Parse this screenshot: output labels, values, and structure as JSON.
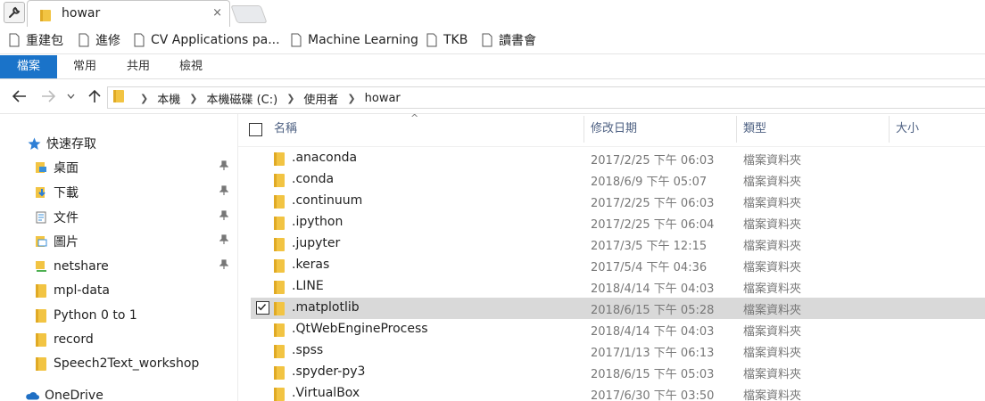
{
  "browser": {
    "tab_title": "howar",
    "tab_close": "×"
  },
  "bookmarks": [
    {
      "label": "重建包"
    },
    {
      "label": "進修"
    },
    {
      "label": "CV Applications pa..."
    },
    {
      "label": "Machine Learning"
    },
    {
      "label": "TKB"
    },
    {
      "label": "讀書會"
    }
  ],
  "ribbon": {
    "tabs": [
      {
        "label": "檔案"
      },
      {
        "label": "常用"
      },
      {
        "label": "共用"
      },
      {
        "label": "檢視"
      }
    ]
  },
  "address": {
    "crumbs": [
      "本機",
      "本機磁碟 (C:)",
      "使用者",
      "howar"
    ]
  },
  "nav": {
    "items": [
      {
        "label": "快速存取",
        "icon": "star-icon"
      },
      {
        "label": "桌面",
        "icon": "desktop-icon",
        "pinned": true
      },
      {
        "label": "下載",
        "icon": "download-icon",
        "pinned": true
      },
      {
        "label": "文件",
        "icon": "document-icon",
        "pinned": true
      },
      {
        "label": "圖片",
        "icon": "pictures-icon",
        "pinned": true
      },
      {
        "label": "netshare",
        "icon": "network-folder-icon",
        "pinned": true
      },
      {
        "label": "mpl-data",
        "icon": "folder-icon"
      },
      {
        "label": "Python 0 to 1",
        "icon": "folder-icon"
      },
      {
        "label": "record",
        "icon": "folder-icon"
      },
      {
        "label": "Speech2Text_workshop",
        "icon": "folder-icon"
      },
      {
        "label": "OneDrive",
        "icon": "cloud-icon"
      }
    ]
  },
  "columns": {
    "name": "名稱",
    "date": "修改日期",
    "type": "類型",
    "size": "大小",
    "sort_indicator": "^"
  },
  "files": [
    {
      "name": ".anaconda",
      "date": "2017/2/25 下午 06:03",
      "type": "檔案資料夾"
    },
    {
      "name": ".conda",
      "date": "2018/6/9 下午 05:07",
      "type": "檔案資料夾"
    },
    {
      "name": ".continuum",
      "date": "2017/2/25 下午 06:03",
      "type": "檔案資料夾"
    },
    {
      "name": ".ipython",
      "date": "2017/2/25 下午 06:04",
      "type": "檔案資料夾"
    },
    {
      "name": ".jupyter",
      "date": "2017/3/5 下午 12:15",
      "type": "檔案資料夾"
    },
    {
      "name": ".keras",
      "date": "2017/5/4 下午 04:36",
      "type": "檔案資料夾"
    },
    {
      "name": ".LINE",
      "date": "2018/4/14 下午 04:03",
      "type": "檔案資料夾"
    },
    {
      "name": ".matplotlib",
      "date": "2018/6/15 下午 05:28",
      "type": "檔案資料夾",
      "selected": true
    },
    {
      "name": ".QtWebEngineProcess",
      "date": "2018/4/14 下午 04:03",
      "type": "檔案資料夾"
    },
    {
      "name": ".spss",
      "date": "2017/1/13 下午 06:13",
      "type": "檔案資料夾"
    },
    {
      "name": ".spyder-py3",
      "date": "2018/6/15 下午 05:03",
      "type": "檔案資料夾"
    },
    {
      "name": ".VirtualBox",
      "date": "2017/6/30 下午 03:50",
      "type": "檔案資料夾"
    }
  ],
  "colors": {
    "accent": "#1a73c9",
    "folder": "#f2c443",
    "selected_row": "#d9d9d9",
    "header_text": "#4d6082",
    "secondary_text": "#777777"
  }
}
